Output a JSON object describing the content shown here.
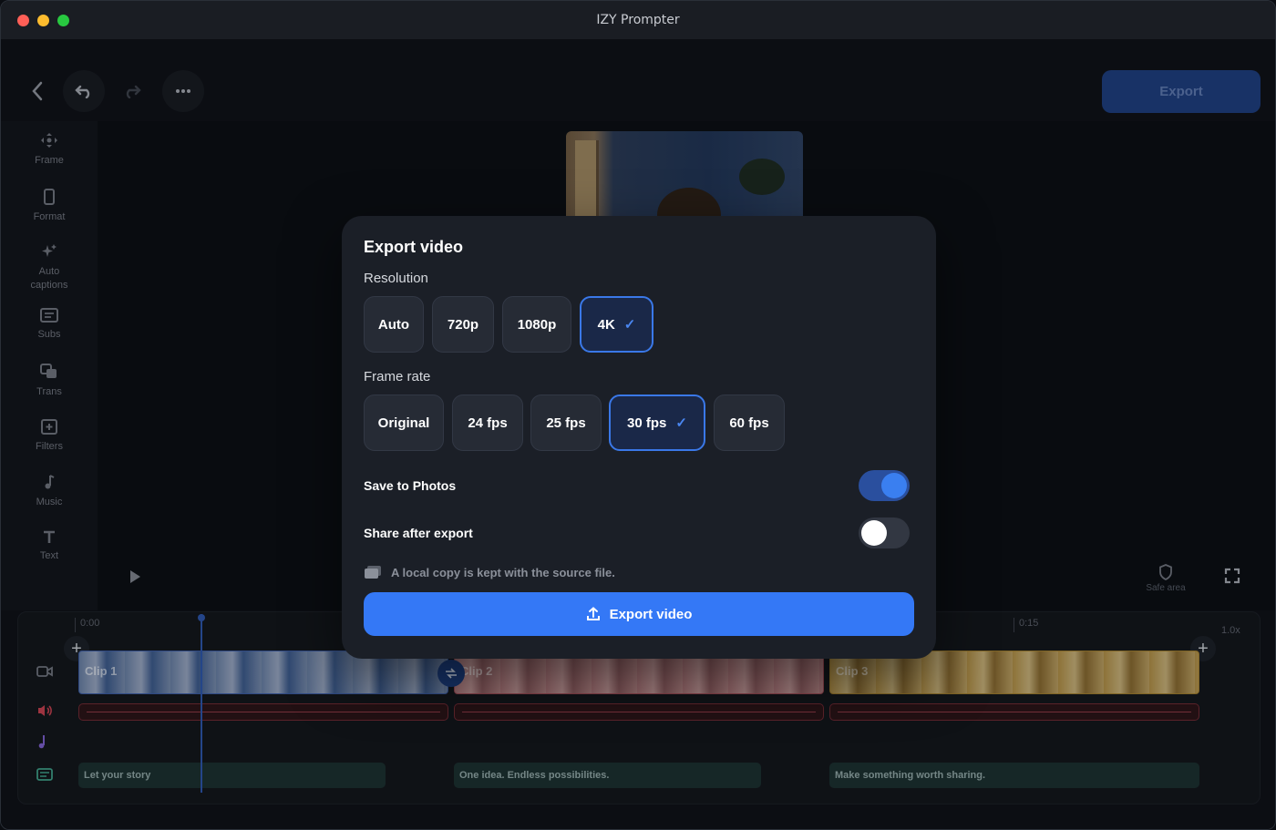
{
  "app": {
    "title": "IZY Prompter"
  },
  "toolbar": {
    "export_label": "Export"
  },
  "sidebar": {
    "items": [
      {
        "label": "Frame",
        "icon": "move-icon"
      },
      {
        "label": "Format",
        "icon": "phone-frame-icon"
      },
      {
        "label": "Auto captions",
        "icon": "sparkle-icon"
      },
      {
        "label": "Subs",
        "icon": "subtitles-icon"
      },
      {
        "label": "Trans",
        "icon": "transitions-icon"
      },
      {
        "label": "Filters",
        "icon": "filters-icon"
      },
      {
        "label": "Music",
        "icon": "music-note-icon"
      },
      {
        "label": "Text",
        "icon": "text-icon"
      }
    ]
  },
  "preview": {
    "safe_area_label": "Safe area"
  },
  "timeline": {
    "time_start": "0:00",
    "time_mid": "0:15",
    "speed": "1.0x",
    "clips": [
      "Clip 1",
      "Clip 2",
      "Clip 3"
    ],
    "captions": [
      "Let your story",
      "One idea. Endless possibilities.",
      "Make something worth sharing."
    ]
  },
  "modal": {
    "title": "Export video",
    "resolution_label": "Resolution",
    "resolutions": [
      "Auto",
      "720p",
      "1080p",
      "4K"
    ],
    "selected_resolution": "4K",
    "frame_rate_label": "Frame rate",
    "frame_rates": [
      "Original",
      "24 fps",
      "25 fps",
      "30 fps",
      "60 fps"
    ],
    "selected_frame_rate": "30 fps",
    "save_to_photos_label": "Save to Photos",
    "save_to_photos_on": true,
    "share_after_export_label": "Share after export",
    "share_after_export_on": false,
    "note": "A local copy is kept with the source file.",
    "export_button_label": "Export video"
  },
  "colors": {
    "accent": "#3478f6",
    "modal_bg": "#1b1f27"
  }
}
